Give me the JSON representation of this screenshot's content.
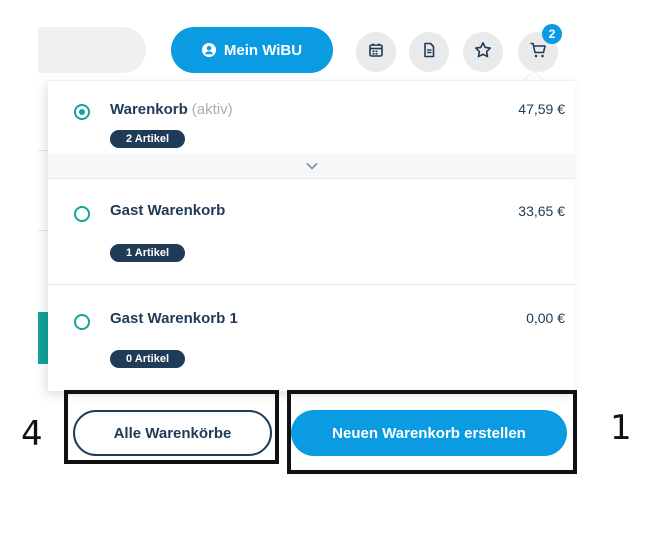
{
  "header": {
    "account_label": "Mein WiBU",
    "cart_badge": "2",
    "icons": [
      "calendar-icon",
      "document-icon",
      "star-icon",
      "cart-icon"
    ]
  },
  "carts": [
    {
      "name": "Warenkorb",
      "state": "(aktiv)",
      "price": "47,59 €",
      "count": "2 Artikel",
      "selected": true
    },
    {
      "name": "Gast Warenkorb",
      "state": "",
      "price": "33,65 €",
      "count": "1 Artikel",
      "selected": false
    },
    {
      "name": "Gast Warenkorb 1",
      "state": "",
      "price": "0,00 €",
      "count": "0 Artikel",
      "selected": false
    }
  ],
  "actions": {
    "all_carts_label": "Alle Warenkörbe",
    "new_cart_label": "Neuen Warenkorb erstellen"
  },
  "annotations": {
    "left_number": "4",
    "right_number": "1"
  },
  "colors": {
    "primary": "#0b9be3",
    "navy": "#1f3b57",
    "teal": "#13a39b"
  }
}
